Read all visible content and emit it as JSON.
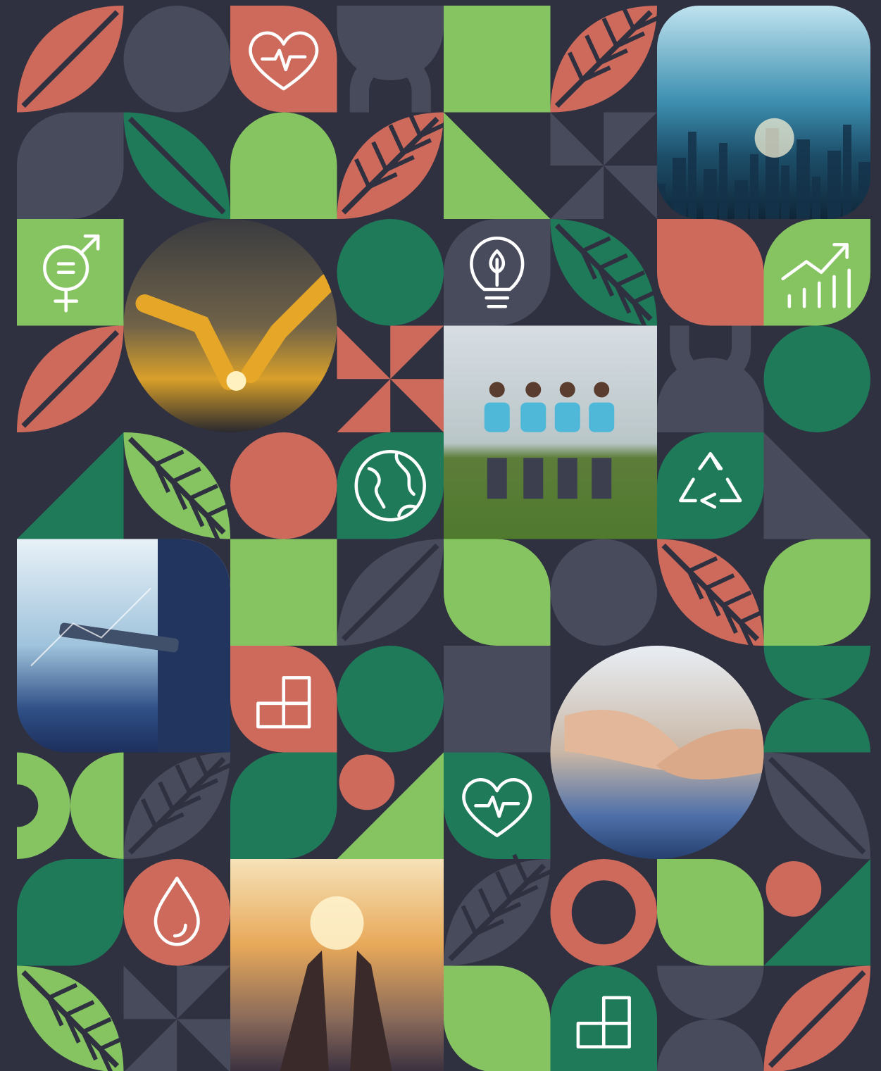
{
  "palette": {
    "background": "#2f3140",
    "dark_gray": "#484b5c",
    "coral": "#cd6a5c",
    "coral_light": "#e1776a",
    "green_light": "#86c462",
    "green_dark": "#1f7a59",
    "icon_stroke": "#ffffff"
  },
  "tiles": [
    {
      "row": 0,
      "col": 0,
      "shape": "leaf",
      "color": "coral",
      "rot": 0
    },
    {
      "row": 0,
      "col": 1,
      "shape": "circle",
      "color": "dark_gray"
    },
    {
      "row": 0,
      "col": 2,
      "shape": "petal",
      "color": "coral",
      "rot": 0,
      "icon": "heart-pulse-icon"
    },
    {
      "row": 0,
      "col": 3,
      "shape": "arch-ring",
      "color": "dark_gray",
      "rot": 0
    },
    {
      "row": 0,
      "col": 4,
      "shape": "square",
      "color": "green_light"
    },
    {
      "row": 0,
      "col": 5,
      "shape": "leaf-striped",
      "color": "coral",
      "rot": 0
    },
    {
      "row": 1,
      "col": 0,
      "shape": "petal",
      "color": "dark_gray",
      "rot": 270
    },
    {
      "row": 1,
      "col": 1,
      "shape": "leaf",
      "color": "green_dark",
      "rot": 90
    },
    {
      "row": 1,
      "col": 2,
      "shape": "arch",
      "color": "green_light",
      "rot": 0
    },
    {
      "row": 1,
      "col": 3,
      "shape": "leaf-striped",
      "color": "coral",
      "rot": 0
    },
    {
      "row": 1,
      "col": 4,
      "shape": "triangle",
      "color": "green_light",
      "rot": 0
    },
    {
      "row": 1,
      "col": 5,
      "shape": "pinwheel",
      "color": "dark_gray"
    },
    {
      "row": 2,
      "col": 0,
      "shape": "square",
      "color": "green_light",
      "icon": "gender-equality-icon"
    },
    {
      "row": 2,
      "col": 3,
      "shape": "circle",
      "color": "green_dark"
    },
    {
      "row": 2,
      "col": 4,
      "shape": "petal",
      "color": "dark_gray",
      "rot": 90,
      "icon": "lightbulb-leaf-icon"
    },
    {
      "row": 2,
      "col": 5,
      "shape": "leaf-striped",
      "color": "green_dark",
      "rot": 90
    },
    {
      "row": 2,
      "col": 6,
      "shape": "petal",
      "color": "coral",
      "rot": 0
    },
    {
      "row": 2,
      "col": 7,
      "shape": "petal",
      "color": "green_light",
      "rot": 270,
      "icon": "growth-chart-icon"
    },
    {
      "row": 3,
      "col": 0,
      "shape": "leaf",
      "color": "coral",
      "rot": 0
    },
    {
      "row": 3,
      "col": 3,
      "shape": "pinwheel",
      "color": "coral"
    },
    {
      "row": 3,
      "col": 6,
      "shape": "arch-ring",
      "color": "dark_gray",
      "rot": 180
    },
    {
      "row": 3,
      "col": 7,
      "shape": "circle",
      "color": "green_dark"
    },
    {
      "row": 4,
      "col": 0,
      "shape": "triangle",
      "color": "green_dark",
      "rot": 270
    },
    {
      "row": 4,
      "col": 1,
      "shape": "leaf-striped",
      "color": "green_light",
      "rot": 90
    },
    {
      "row": 4,
      "col": 2,
      "shape": "circle",
      "color": "coral"
    },
    {
      "row": 4,
      "col": 3,
      "shape": "petal",
      "color": "green_dark",
      "rot": 90,
      "icon": "globe-icon"
    },
    {
      "row": 4,
      "col": 6,
      "shape": "petal",
      "color": "green_dark",
      "rot": 90,
      "icon": "recycle-icon"
    },
    {
      "row": 4,
      "col": 7,
      "shape": "triangle",
      "color": "dark_gray",
      "rot": 0
    },
    {
      "row": 5,
      "col": 2,
      "shape": "square",
      "color": "green_light"
    },
    {
      "row": 5,
      "col": 3,
      "shape": "leaf",
      "color": "dark_gray",
      "rot": 0
    },
    {
      "row": 5,
      "col": 4,
      "shape": "petal",
      "color": "green_light",
      "rot": 180
    },
    {
      "row": 5,
      "col": 5,
      "shape": "circle",
      "color": "dark_gray"
    },
    {
      "row": 5,
      "col": 6,
      "shape": "leaf-striped",
      "color": "coral",
      "rot": 90
    },
    {
      "row": 5,
      "col": 7,
      "shape": "petal",
      "color": "green_light",
      "rot": 270
    },
    {
      "row": 6,
      "col": 2,
      "shape": "petal",
      "color": "coral",
      "rot": 0,
      "icon": "blocks-icon"
    },
    {
      "row": 6,
      "col": 3,
      "shape": "circle",
      "color": "green_dark"
    },
    {
      "row": 6,
      "col": 4,
      "shape": "square",
      "color": "dark_gray"
    },
    {
      "row": 6,
      "col": 7,
      "shape": "halves",
      "color": "green_dark"
    },
    {
      "row": 7,
      "col": 0,
      "shape": "half-circles",
      "color": "green_light"
    },
    {
      "row": 7,
      "col": 1,
      "shape": "leaf-striped",
      "color": "dark_gray",
      "rot": 0
    },
    {
      "row": 7,
      "col": 2,
      "shape": "petal",
      "color": "green_dark",
      "rot": 270
    },
    {
      "row": 7,
      "col": 3,
      "shape": "triangle-dot",
      "color": "green_light"
    },
    {
      "row": 7,
      "col": 4,
      "shape": "petal",
      "color": "green_dark",
      "rot": 0,
      "icon": "heart-pulse-icon"
    },
    {
      "row": 7,
      "col": 7,
      "shape": "leaf",
      "color": "dark_gray",
      "rot": 90
    },
    {
      "row": 8,
      "col": 0,
      "shape": "petal",
      "color": "green_dark",
      "rot": 270
    },
    {
      "row": 8,
      "col": 1,
      "shape": "circle",
      "color": "coral",
      "icon": "water-drop-icon"
    },
    {
      "row": 8,
      "col": 4,
      "shape": "leaf-striped",
      "color": "dark_gray",
      "rot": 0
    },
    {
      "row": 8,
      "col": 5,
      "shape": "ring",
      "color": "coral"
    },
    {
      "row": 8,
      "col": 6,
      "shape": "petal",
      "color": "green_light",
      "rot": 0
    },
    {
      "row": 8,
      "col": 7,
      "shape": "triangle-dot",
      "color": "green_dark"
    },
    {
      "row": 9,
      "col": 0,
      "shape": "leaf-striped",
      "color": "green_light",
      "rot": 90
    },
    {
      "row": 9,
      "col": 1,
      "shape": "pinwheel",
      "color": "dark_gray"
    },
    {
      "row": 9,
      "col": 4,
      "shape": "petal",
      "color": "green_light",
      "rot": 180
    },
    {
      "row": 9,
      "col": 5,
      "shape": "arch",
      "color": "green_dark",
      "rot": 0,
      "icon": "blocks-icon"
    },
    {
      "row": 9,
      "col": 6,
      "shape": "halves",
      "color": "dark_gray"
    },
    {
      "row": 9,
      "col": 7,
      "shape": "leaf",
      "color": "coral",
      "rot": 0
    }
  ],
  "photos": [
    {
      "name": "photo-city-network",
      "shape": "rounded",
      "col": 6,
      "row": 0,
      "w": 2,
      "h": 2,
      "theme": "city"
    },
    {
      "name": "photo-robotic-arms",
      "shape": "circle",
      "col": 1,
      "row": 2,
      "w": 2,
      "h": 2,
      "theme": "robot"
    },
    {
      "name": "photo-team-walking",
      "shape": "square",
      "col": 4,
      "row": 3,
      "w": 2,
      "h": 2,
      "theme": "team"
    },
    {
      "name": "photo-businessman-tablet",
      "shape": "rounded-right",
      "col": 0,
      "row": 5,
      "w": 2,
      "h": 2,
      "theme": "tablet"
    },
    {
      "name": "photo-handshake",
      "shape": "circle",
      "col": 5,
      "row": 6,
      "w": 2,
      "h": 2,
      "theme": "handshake"
    },
    {
      "name": "photo-hands-lightbulb",
      "shape": "square",
      "col": 2,
      "row": 8,
      "w": 2,
      "h": 2,
      "theme": "hands"
    }
  ]
}
